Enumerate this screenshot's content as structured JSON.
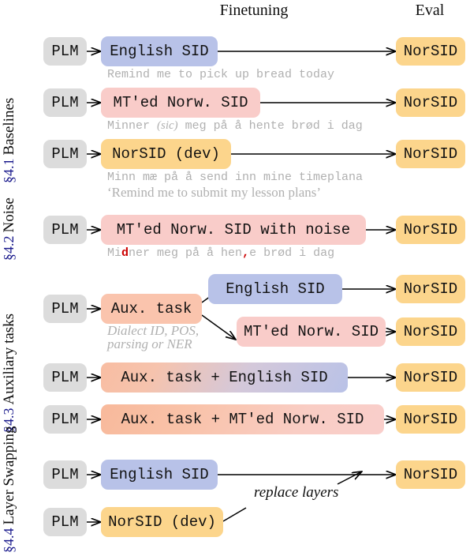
{
  "headers": {
    "finetuning": "Finetuning",
    "eval": "Eval"
  },
  "colors": {
    "plm_box": "#dcdcdc",
    "english_sid_box": "#b8c2e8",
    "mt_norw_box": "#f9ccc9",
    "norsid_box": "#fcd58c",
    "aux_task_box": "#fac4ad",
    "section_number": "#1a1a8c",
    "caption_gray": "#b0b0b0",
    "noise_highlight": "#cc0000",
    "arrow": "#000000"
  },
  "sections": [
    {
      "id": "baselines",
      "number": "§4.1",
      "name": "Baselines"
    },
    {
      "id": "noise",
      "number": "§4.2",
      "name": "Noise"
    },
    {
      "id": "auxiliary",
      "number": "§4.3",
      "name": "Auxiliary tasks"
    },
    {
      "id": "layer-swapping",
      "number": "§4.4",
      "name": "Layer Swapping"
    }
  ],
  "nodes": {
    "plm": "PLM",
    "english_sid": "English SID",
    "mt_norw_sid": "MT'ed Norw. SID",
    "norsid_dev": "NorSID (dev)",
    "mt_norw_sid_noise": "MT'ed Norw. SID with noise",
    "aux_task": "Aux. task",
    "aux_plus_english": "Aux. task + English SID",
    "aux_plus_mt": "Aux. task + MT'ed Norw. SID",
    "norsid_eval": "NorSID"
  },
  "captions": {
    "english_example": "Remind me to pick up bread today",
    "mt_example_pre": "Minner ",
    "mt_example_sic": "(sic)",
    "mt_example_post": " meg på å hente brød i dag",
    "norsid_example_line1": "Minn mæ på å send inn mine timeplana",
    "norsid_example_line2": "‘Remind me to submit my lesson plans’",
    "noise_example_a": "Mi",
    "noise_example_b": "d",
    "noise_example_c": "ner meg på å hen",
    "noise_example_d": ",",
    "noise_example_e": "e brød i dag",
    "aux_task_detail_line1": "Dialect ID, POS,",
    "aux_task_detail_line2": "parsing or NER"
  },
  "annotations": {
    "replace_layers": "replace layers"
  }
}
